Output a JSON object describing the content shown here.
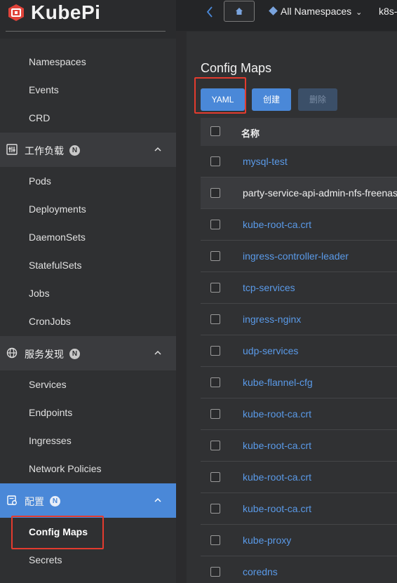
{
  "app": {
    "name": "KubePi"
  },
  "topbar": {
    "namespace": "All Namespaces",
    "cluster": "k8s-"
  },
  "sidebar": {
    "items_top": [
      {
        "label": "Namespaces"
      },
      {
        "label": "Events"
      },
      {
        "label": "CRD"
      }
    ],
    "workload": {
      "label": "工作负载",
      "badge": "N",
      "items": [
        {
          "label": "Pods"
        },
        {
          "label": "Deployments"
        },
        {
          "label": "DaemonSets"
        },
        {
          "label": "StatefulSets"
        },
        {
          "label": "Jobs"
        },
        {
          "label": "CronJobs"
        }
      ]
    },
    "discovery": {
      "label": "服务发现",
      "badge": "N",
      "items": [
        {
          "label": "Services"
        },
        {
          "label": "Endpoints"
        },
        {
          "label": "Ingresses"
        },
        {
          "label": "Network Policies"
        }
      ]
    },
    "config": {
      "label": "配置",
      "badge": "N",
      "items": [
        {
          "label": "Config Maps"
        },
        {
          "label": "Secrets"
        }
      ]
    }
  },
  "main": {
    "title": "Config Maps",
    "buttons": {
      "yaml": "YAML",
      "create": "创建",
      "delete": "删除"
    },
    "table": {
      "header_name": "名称",
      "rows": [
        {
          "name": "mysql-test"
        },
        {
          "name": "party-service-api-admin-nfs-freenas"
        },
        {
          "name": "kube-root-ca.crt"
        },
        {
          "name": "ingress-controller-leader"
        },
        {
          "name": "tcp-services"
        },
        {
          "name": "ingress-nginx"
        },
        {
          "name": "udp-services"
        },
        {
          "name": "kube-flannel-cfg"
        },
        {
          "name": "kube-root-ca.crt"
        },
        {
          "name": "kube-root-ca.crt"
        },
        {
          "name": "kube-root-ca.crt"
        },
        {
          "name": "kube-root-ca.crt"
        },
        {
          "name": "kube-proxy"
        },
        {
          "name": "coredns"
        }
      ]
    }
  },
  "colors": {
    "accent": "#4a88d8",
    "highlight_box": "#e33b2e"
  }
}
